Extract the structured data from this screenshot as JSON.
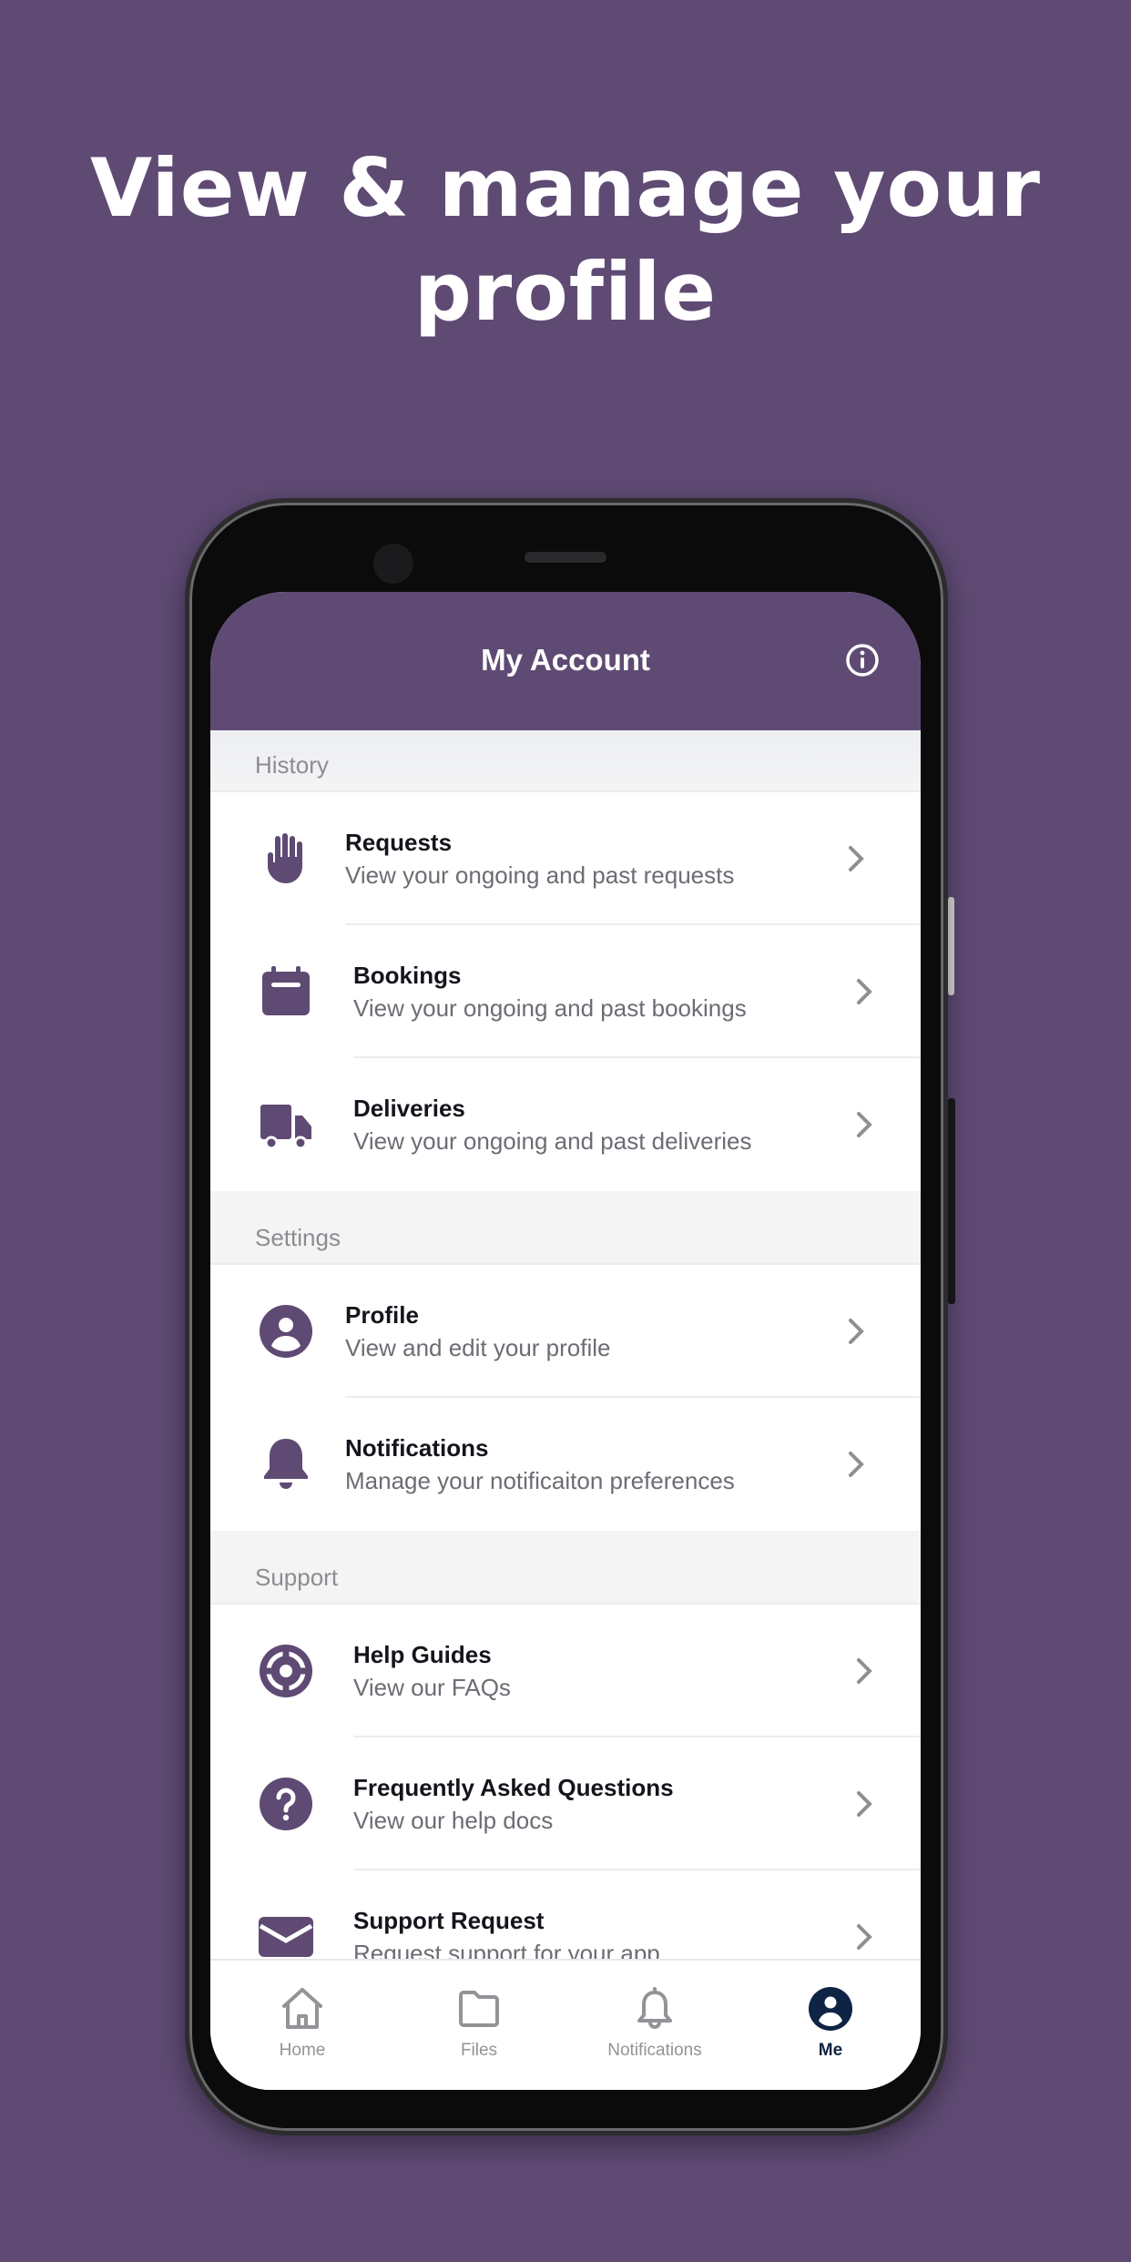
{
  "headline": {
    "line1": "View & manage your",
    "line2": "profile"
  },
  "colors": {
    "brand": "#5f4a74",
    "active_tab": "#0f2444",
    "inactive_tab": "#939398"
  },
  "header": {
    "title": "My Account",
    "info_icon": "info-circle-icon"
  },
  "sections": [
    {
      "label": "History",
      "items": [
        {
          "title": "Requests",
          "subtitle": "View your ongoing and past requests",
          "icon": "hand-icon"
        },
        {
          "title": "Bookings",
          "subtitle": "View your ongoing and past bookings",
          "icon": "calendar-icon"
        },
        {
          "title": "Deliveries",
          "subtitle": "View your ongoing and past deliveries",
          "icon": "truck-icon"
        }
      ]
    },
    {
      "label": "Settings",
      "items": [
        {
          "title": "Profile",
          "subtitle": "View and edit your profile",
          "icon": "user-circle-icon"
        },
        {
          "title": "Notifications",
          "subtitle": "Manage your notificaiton preferences",
          "icon": "bell-icon"
        }
      ]
    },
    {
      "label": "Support",
      "items": [
        {
          "title": "Help Guides",
          "subtitle": "View our FAQs",
          "icon": "lifebuoy-icon"
        },
        {
          "title": "Frequently Asked Questions",
          "subtitle": "View our help docs",
          "icon": "question-circle-icon"
        },
        {
          "title": "Support Request",
          "subtitle": "Request support for your app",
          "icon": "envelope-icon"
        }
      ]
    }
  ],
  "tabs": [
    {
      "label": "Home",
      "icon": "home-icon",
      "active": false
    },
    {
      "label": "Files",
      "icon": "folder-icon",
      "active": false
    },
    {
      "label": "Notifications",
      "icon": "bell-outline-icon",
      "active": false
    },
    {
      "label": "Me",
      "icon": "user-circle-icon",
      "active": true
    }
  ]
}
